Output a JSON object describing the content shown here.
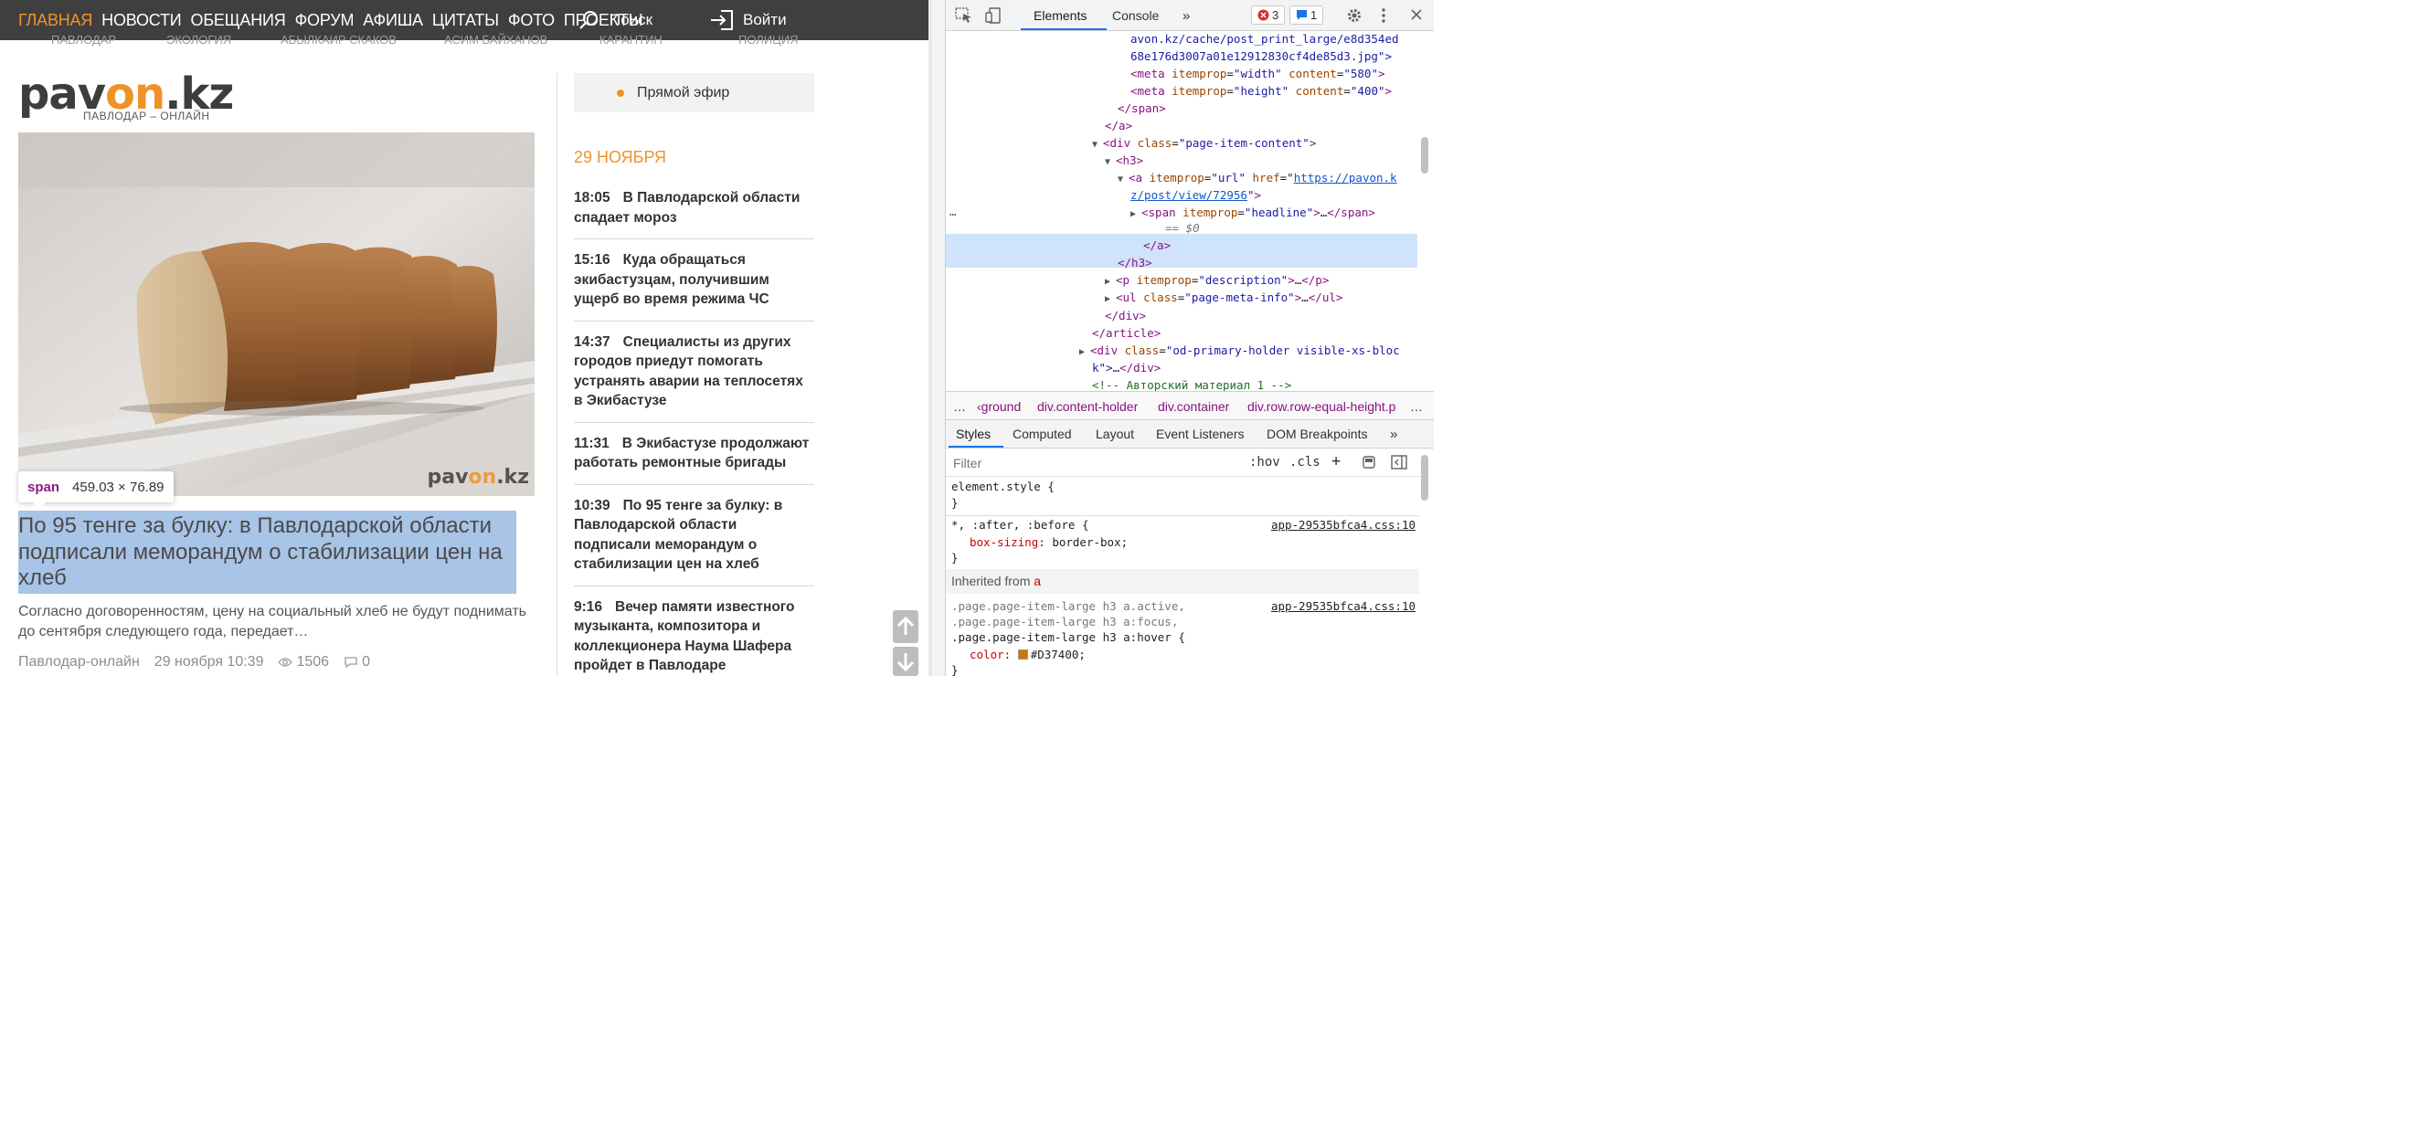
{
  "site": {
    "nav": {
      "links": [
        "ГЛАВНАЯ",
        "НОВОСТИ",
        "ОБЕЩАНИЯ",
        "ФОРУМ",
        "АФИША",
        "ЦИТАТЫ",
        "ФОТО",
        "ПРОЕКТЫ"
      ],
      "active_index": 0,
      "search_label": "Поиск",
      "login_label": "Войти"
    },
    "subnav_tags": [
      "ПАВЛОДАР",
      "ЭКОЛОГИЯ",
      "АБЫЛКАИР СКАКОВ",
      "АСИМ БАЙХАНОВ",
      "КАРАНТИН",
      "ПОЛИЦИЯ"
    ],
    "logo": {
      "part1": "pav",
      "part2": "on",
      "part3": ".kz",
      "subtitle": "ПАВЛОДАР – ОНЛАЙН"
    },
    "image_watermark": {
      "part1": "pav",
      "part2": "on",
      "part3": ".kz"
    },
    "tooltip": {
      "tag": "span",
      "size": "459.03 × 76.89"
    },
    "article": {
      "headline": "По 95 тенге за булку: в Павлодарской области подписали меморандум о стабилизации цен на хлеб",
      "description": "Согласно договоренностям, цену на социальный хлеб не будут поднимать до сентября следующего года, передает…",
      "source": "Павлодар-онлайн",
      "date": "29 ноября 10:39",
      "views": "1506",
      "comments": "0"
    },
    "live_label": "Прямой эфир",
    "news_date": "29 НОЯБРЯ",
    "news": [
      {
        "time": "18:05",
        "title": "В Павлодарской области спадает мороз"
      },
      {
        "time": "15:16",
        "title": "Куда обращаться экибастузцам, получившим ущерб во время режима ЧС"
      },
      {
        "time": "14:37",
        "title": "Специалисты из других городов приедут помогать устранять аварии на теплосетях в Экибастузе"
      },
      {
        "time": "11:31",
        "title": "В Экибастузе продолжают работать ремонтные бригады"
      },
      {
        "time": "10:39",
        "title": "По 95 тенге за булку: в Павлодарской области подписали меморандум о стабилизации цен на хлеб"
      },
      {
        "time": "9:16",
        "title": "Вечер памяти известного музыканта, композитора и коллекционера Наума Шафера пройдет в Павлодаре"
      }
    ],
    "colors": {
      "accent": "#f0922a",
      "nav_bg": "#3f3f3f",
      "highlight": "#a8c4e6"
    }
  },
  "devtools": {
    "tabs": [
      "Elements",
      "Console"
    ],
    "more_tabs": "»",
    "error_count": "3",
    "message_count": "1",
    "dom": {
      "line1": "avon.kz/cache/post_print_large/e8d354ed",
      "line2": "68e176d3007a01e12912830cf4de85d3.jpg\">",
      "meta_tag": "meta",
      "itemprop_attr": "itemprop",
      "content_attr": "content",
      "width_val": "\"width\"",
      "width_content": "\"580\"",
      "height_val": "\"height\"",
      "height_content": "\"400\"",
      "span_close": "</span>",
      "a_close": "</a>",
      "div_tag": "div",
      "class_attr": "class",
      "page_item_content": "\"page-item-content\"",
      "h3_open": "<h3>",
      "a_tag": "a",
      "url_val": "\"url\"",
      "href_attr": "href",
      "href_1": "https://pavon.k",
      "href_2": "z/post/view/72956",
      "span_tag": "span",
      "headline_val": "\"headline\"",
      "ellipsis": "…",
      "eq0": "== $0",
      "h3_close": "</h3>",
      "p_tag": "p",
      "description_val": "\"description\"",
      "p_close": "</p>",
      "ul_tag": "ul",
      "page_meta_info": "\"page-meta-info\"",
      "ul_close": "</ul>",
      "div_close": "</div>",
      "article_close": "</article>",
      "od_primary_1": "\"od-primary-holder visible-xs-bloc",
      "od_primary_2": "k\">",
      "comment": "<!-- Авторский материал 1 -->"
    },
    "breadcrumbs": [
      "…",
      "‹ground",
      "div.content-holder",
      "div.container",
      "div.row.row-equal-height.p",
      "…"
    ],
    "style_tabs": [
      "Styles",
      "Computed",
      "Layout",
      "Event Listeners",
      "DOM Breakpoints",
      "»"
    ],
    "filter_placeholder": "Filter",
    "hov": ":hov",
    "cls": ".cls",
    "plus": "+",
    "css": {
      "element_style": "element.style {",
      "close": "}",
      "universal_sel": "*, :after, :before {",
      "source": "app-29535bfca4.css:10",
      "box_sizing_prop": "box-sizing",
      "box_sizing_val": "border-box;",
      "inherited_label": "Inherited from",
      "inherited_tag": "a",
      "rule2_line1": ".page.page-item-large h3 a.active,",
      "rule2_line2": ".page.page-item-large h3 a:focus,",
      "rule2_line3": ".page.page-item-large h3 a:hover {",
      "color_prop": "color",
      "color_val": "#D37400;",
      "swatch_color": "#D37400"
    }
  }
}
